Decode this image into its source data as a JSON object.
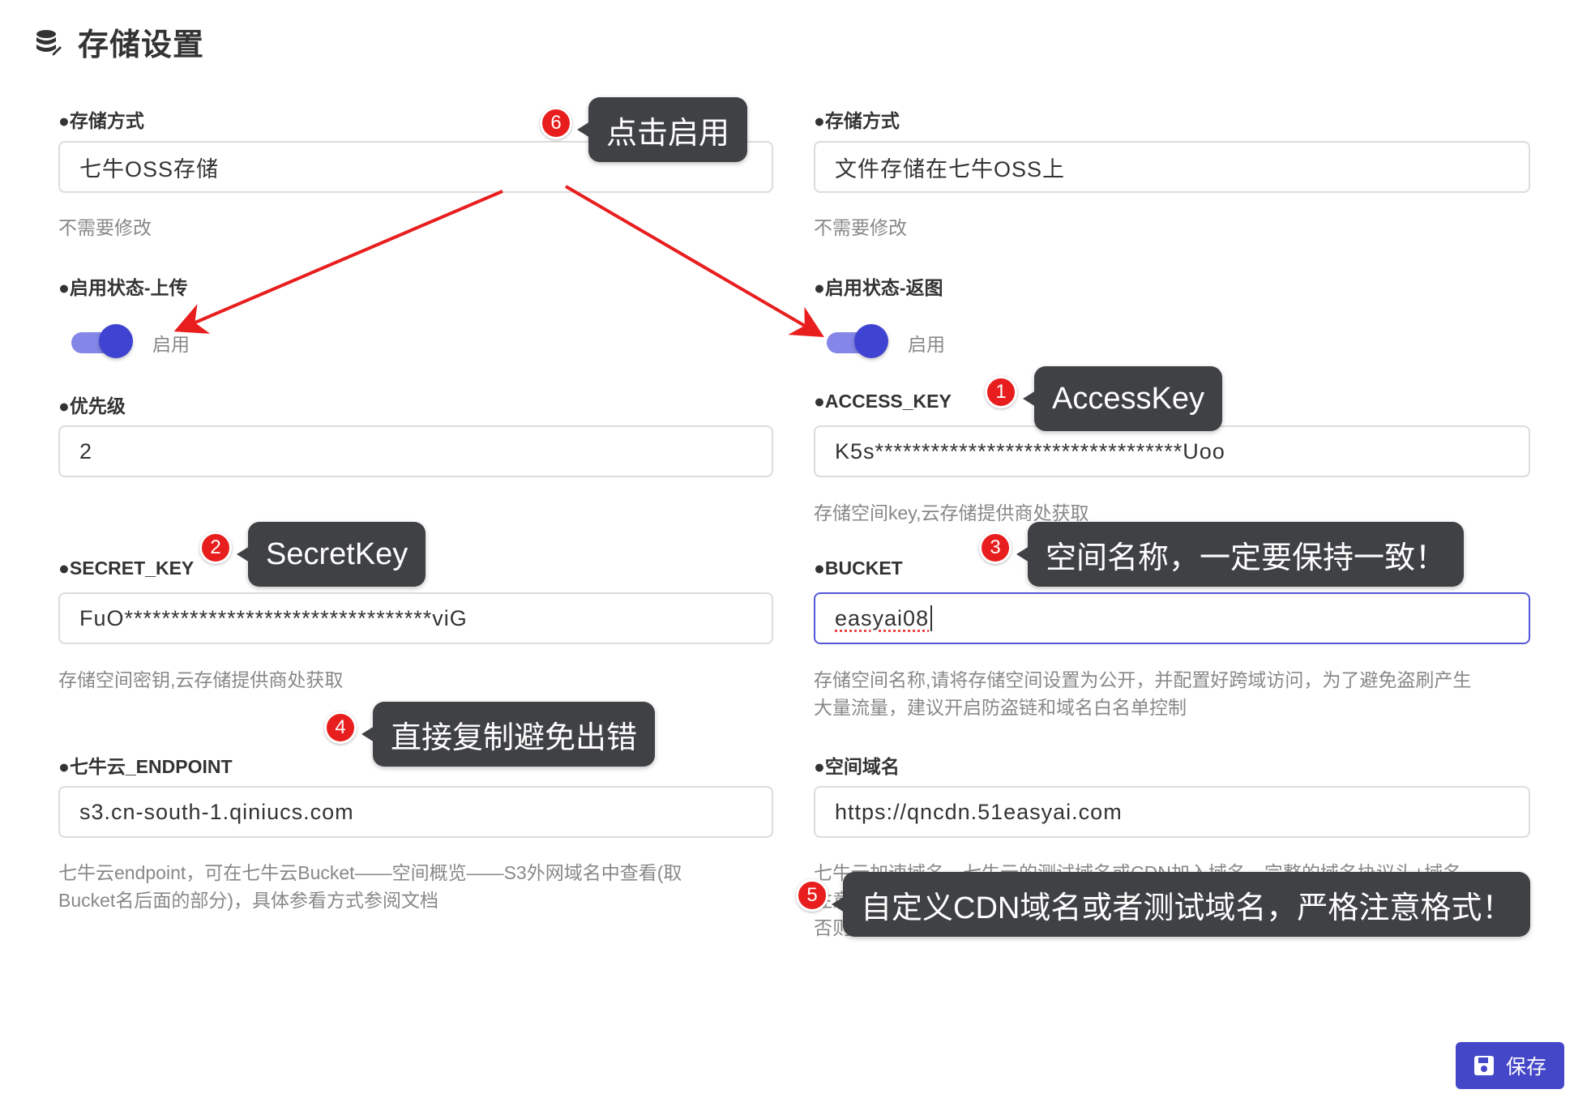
{
  "header": {
    "title": "存储设置",
    "icon": "database-settings-icon"
  },
  "left": {
    "storage_method": {
      "label": "●存储方式",
      "value": "七牛OSS存储",
      "hint": "不需要修改"
    },
    "upload_status": {
      "label": "●启用状态-上传",
      "toggle_label": "启用",
      "enabled": true
    },
    "priority": {
      "label": "●优先级",
      "value": "2"
    },
    "secret_key": {
      "label": "●SECRET_KEY",
      "value": "FuO*********************************viG",
      "hint": "存储空间密钥,云存储提供商处获取"
    },
    "endpoint": {
      "label": "●七牛云_ENDPOINT",
      "value": "s3.cn-south-1.qiniucs.com",
      "hint_line1": "七牛云endpoint，可在七牛云Bucket——空间概览——S3外网域名中查看(取",
      "hint_line2": "Bucket名后面的部分)，具体参看方式参阅文档"
    }
  },
  "right": {
    "storage_method": {
      "label": "●存储方式",
      "value": "文件存储在七牛OSS上",
      "hint": "不需要修改"
    },
    "return_status": {
      "label": "●启用状态-返图",
      "toggle_label": "启用",
      "enabled": true
    },
    "access_key": {
      "label": "●ACCESS_KEY",
      "value": "K5s*********************************Uoo",
      "hint": "存储空间key,云存储提供商处获取"
    },
    "bucket": {
      "label": "●BUCKET",
      "value": "easyai08",
      "hint_line1": "存储空间名称,请将存储空间设置为公开，并配置好跨域访问，为了避免盗刷产生",
      "hint_line2": "大量流量，建议开启防盗链和域名白名单控制"
    },
    "domain": {
      "label": "●空间域名",
      "value": "https://qncdn.51easyai.com",
      "hint_line1": "七牛云加速域名，七牛云的测试域名或CDN加入域名，完整的域名协议头+域名,",
      "hint_line2": "注意",
      "hint_line3": "否则无法使用"
    }
  },
  "annotations": [
    {
      "num": "1",
      "text": "AccessKey"
    },
    {
      "num": "2",
      "text": "SecretKey"
    },
    {
      "num": "3",
      "text": "空间名称，一定要保持一致！"
    },
    {
      "num": "4",
      "text": "直接复制避免出错"
    },
    {
      "num": "5",
      "text": "自定义CDN域名或者测试域名，严格注意格式！"
    },
    {
      "num": "6",
      "text": "点击启用"
    }
  ],
  "save_button": {
    "label": "保存",
    "icon": "floppy-disk-icon"
  },
  "colors": {
    "accent": "#4547c9",
    "toggle_track": "#8486e8",
    "annotation_red": "#e81e1e",
    "bubble_bg": "#3f4144"
  }
}
